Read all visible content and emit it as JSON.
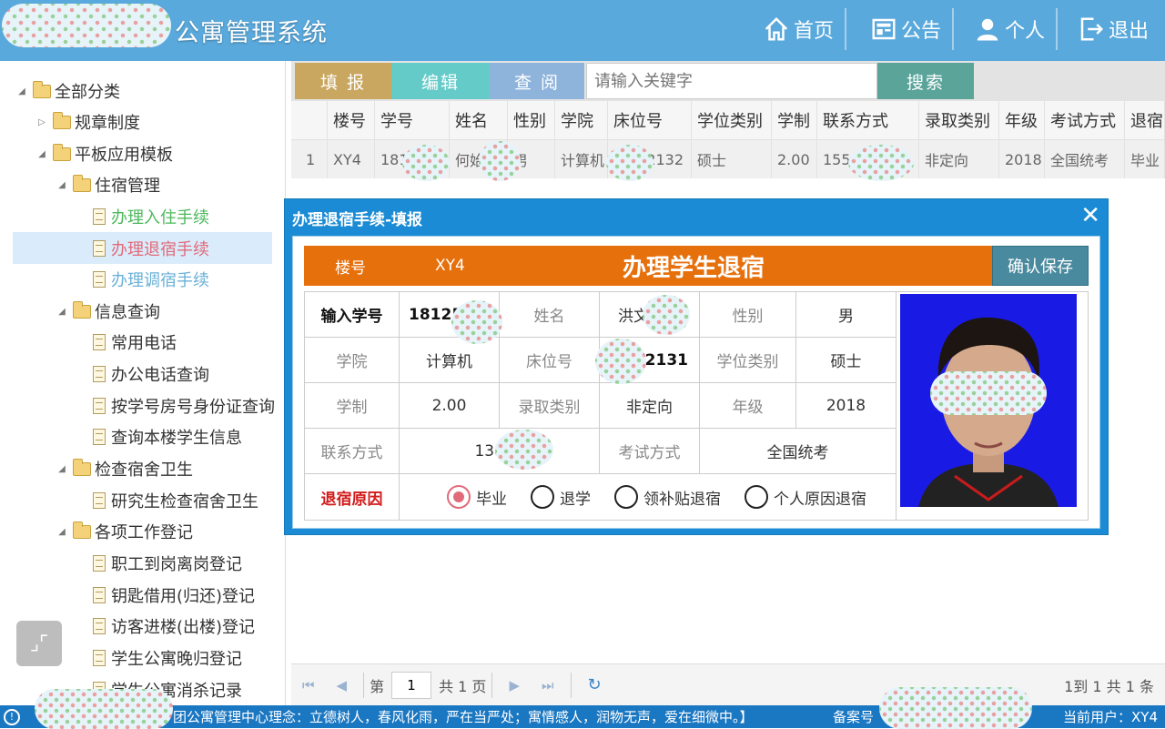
{
  "header": {
    "app_title": "公寓管理系统",
    "nav": [
      {
        "label": "首页",
        "icon": "home-icon"
      },
      {
        "label": "公告",
        "icon": "notice-icon"
      },
      {
        "label": "个人",
        "icon": "person-icon"
      },
      {
        "label": "退出",
        "icon": "logout-icon"
      }
    ]
  },
  "sidebar": {
    "items": [
      {
        "label": "全部分类",
        "type": "folder",
        "expanded": true
      },
      {
        "label": "规章制度",
        "type": "folder",
        "expanded": false
      },
      {
        "label": "平板应用模板",
        "type": "folder",
        "expanded": true
      },
      {
        "label": "住宿管理",
        "type": "folder",
        "expanded": true
      },
      {
        "label": "办理入住手续",
        "type": "doc",
        "color": "#4cb85c"
      },
      {
        "label": "办理退宿手续",
        "type": "doc",
        "color": "#e06a7a",
        "selected": true
      },
      {
        "label": "办理调宿手续",
        "type": "doc",
        "color": "#6ab0d8"
      },
      {
        "label": "信息查询",
        "type": "folder",
        "expanded": true
      },
      {
        "label": "常用电话",
        "type": "doc"
      },
      {
        "label": "办公电话查询",
        "type": "doc"
      },
      {
        "label": "按学号房号身份证查询",
        "type": "doc"
      },
      {
        "label": "查询本楼学生信息",
        "type": "doc"
      },
      {
        "label": "检查宿舍卫生",
        "type": "folder",
        "expanded": true
      },
      {
        "label": "研究生检查宿舍卫生",
        "type": "doc"
      },
      {
        "label": "各项工作登记",
        "type": "folder",
        "expanded": true
      },
      {
        "label": "职工到岗离岗登记",
        "type": "doc"
      },
      {
        "label": "钥匙借用(归还)登记",
        "type": "doc"
      },
      {
        "label": "访客进楼(出楼)登记",
        "type": "doc"
      },
      {
        "label": "学生公寓晚归登记",
        "type": "doc"
      },
      {
        "label": "学生公寓消杀记录",
        "type": "doc"
      }
    ]
  },
  "toolbar": {
    "fill_label": "填 报",
    "edit_label": "编辑",
    "view_label": "查 阅",
    "search_placeholder": "请输入关键字",
    "search_label": "搜索"
  },
  "grid": {
    "headers": [
      "",
      "楼号",
      "学号",
      "姓名",
      "性别",
      "学院",
      "床位号",
      "学位类别",
      "学制",
      "联系方式",
      "录取类别",
      "年级",
      "考试方式",
      "退宿"
    ],
    "rows": [
      [
        "1",
        "XY4",
        "181",
        "何始",
        "男",
        "计算机",
        "2132",
        "硕士",
        "2.00",
        "155",
        "非定向",
        "2018",
        "全国统考",
        "毕业"
      ]
    ]
  },
  "pager": {
    "page_label": "第",
    "page_value": "1",
    "total_label": "共 1 页",
    "info": "1到 1 共 1 条"
  },
  "footer": {
    "motto": "团公寓管理中心理念：立德树人，春风化雨，严在当严处；寓情感人，润物无声，爱在细微中。】",
    "record_label": "备案号",
    "current_user": "当前用户：XY4"
  },
  "modal": {
    "title": "办理退宿手续-填报",
    "close_icon": "close-icon",
    "building_label": "楼号",
    "building_value": "XY4",
    "form_title": "办理学生退宿",
    "confirm_label": "确认保存",
    "fields": {
      "student_id_label": "输入学号",
      "student_id_value": "18125",
      "name_label": "姓名",
      "name_value": "洪文",
      "gender_label": "性别",
      "gender_value": "男",
      "college_label": "学院",
      "college_value": "计算机",
      "bed_label": "床位号",
      "bed_value": "12131",
      "degree_label": "学位类别",
      "degree_value": "硕士",
      "duration_label": "学制",
      "duration_value": "2.00",
      "admission_label": "录取类别",
      "admission_value": "非定向",
      "grade_label": "年级",
      "grade_value": "2018",
      "contact_label": "联系方式",
      "contact_value": "13801",
      "exam_label": "考试方式",
      "exam_value": "全国统考",
      "reason_label": "退宿原因"
    },
    "reasons": [
      {
        "label": "毕业",
        "selected": true
      },
      {
        "label": "退学",
        "selected": false
      },
      {
        "label": "领补贴退宿",
        "selected": false
      },
      {
        "label": "个人原因退宿",
        "selected": false
      }
    ]
  }
}
